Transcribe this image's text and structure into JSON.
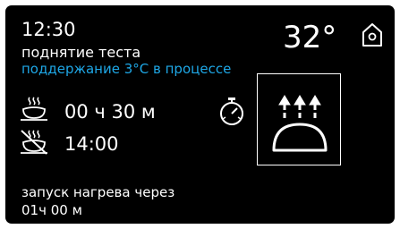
{
  "header": {
    "clock": "12:30",
    "program_name": "поднятие теста",
    "status_text": "поддержание 3°C в процессе",
    "temperature": "32°"
  },
  "cooking": {
    "duration": "00 ч 30 м",
    "end_time": "14:00"
  },
  "footer": {
    "label": "запуск нагрева через",
    "countdown": "01ч 00 м"
  },
  "icons": {
    "home": "home-icon",
    "cooking_duration": "steaming-pot-icon",
    "delayed_start": "crossed-pot-icon",
    "timer": "stopwatch-icon",
    "heating_mode": "dough-proving-icon"
  },
  "colors": {
    "background": "#000000",
    "text": "#ffffff",
    "status_accent": "#1ea7e6"
  }
}
